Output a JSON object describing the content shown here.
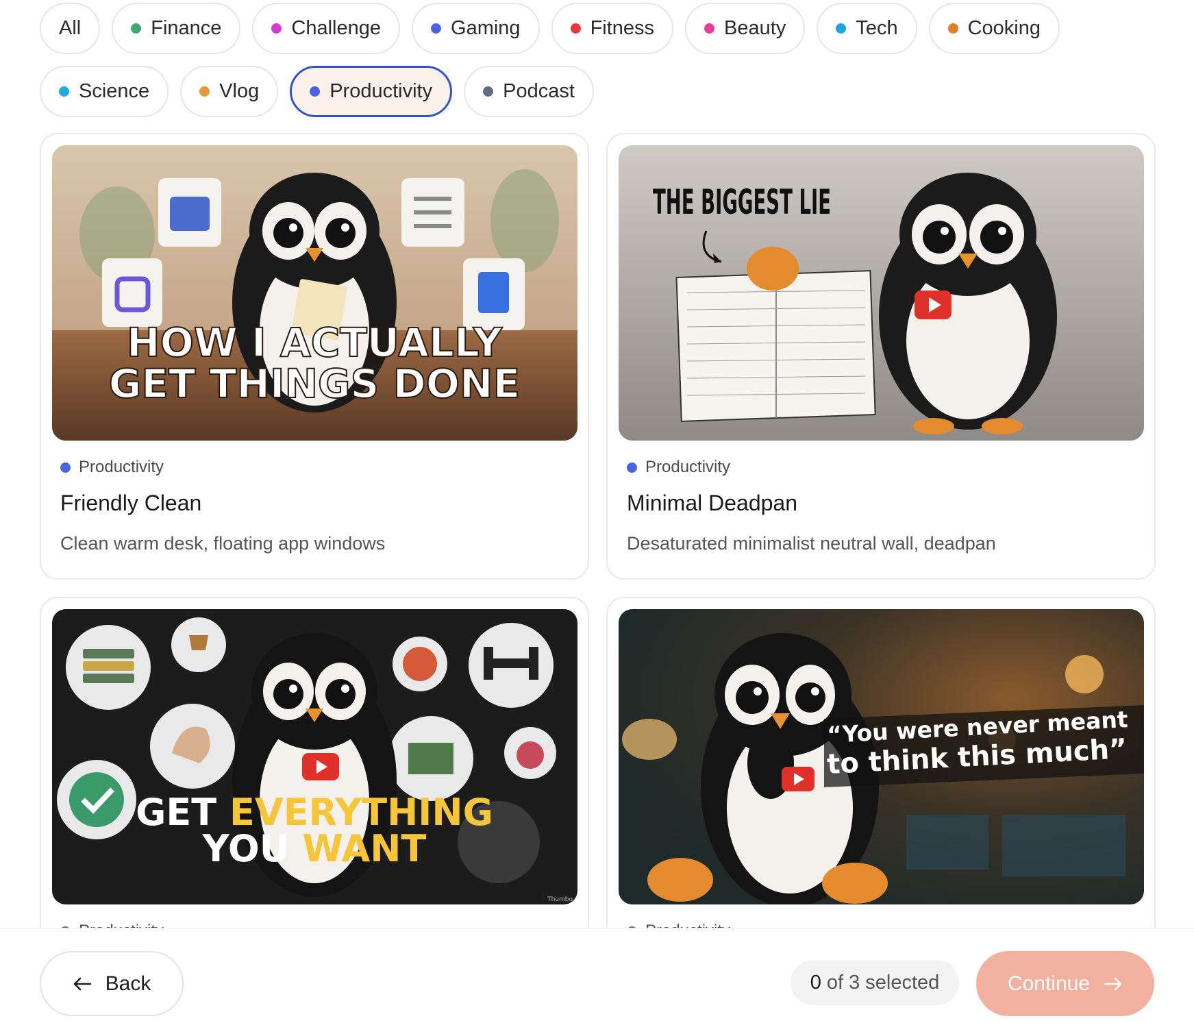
{
  "filters": [
    {
      "label": "All",
      "dot": ""
    },
    {
      "label": "Finance",
      "dot": "#3fa877"
    },
    {
      "label": "Challenge",
      "dot": "#d23ad0"
    },
    {
      "label": "Gaming",
      "dot": "#4a63e0"
    },
    {
      "label": "Fitness",
      "dot": "#e43a3f"
    },
    {
      "label": "Beauty",
      "dot": "#e23f9a"
    },
    {
      "label": "Tech",
      "dot": "#22a2e0"
    },
    {
      "label": "Cooking",
      "dot": "#e0802a"
    },
    {
      "label": "Science",
      "dot": "#22a9e0"
    },
    {
      "label": "Vlog",
      "dot": "#e49a3a"
    },
    {
      "label": "Productivity",
      "dot": "#4a63e0",
      "active": true
    },
    {
      "label": "Podcast",
      "dot": "#5f6f7d"
    }
  ],
  "cards": [
    {
      "category": "Productivity",
      "category_color": "#4a63e0",
      "title": "Friendly Clean",
      "description": "Clean warm desk, floating app windows",
      "thumb_text_lines": [
        "HOW I ACTUALLY",
        "GET THINGS DONE"
      ]
    },
    {
      "category": "Productivity",
      "category_color": "#4a63e0",
      "title": "Minimal Deadpan",
      "description": "Desaturated minimalist neutral wall, deadpan",
      "thumb_text_lines": [
        "THE BIGGEST LIE"
      ]
    },
    {
      "category": "Productivity",
      "category_color": "#4a63e0",
      "title": "",
      "description": "",
      "thumb_text_lines": [
        "GET ",
        "EVERYTHING",
        "YOU ",
        "WANT"
      ],
      "watermark": "Thumbo"
    },
    {
      "category": "Productivity",
      "category_color": "#4a63e0",
      "title": "",
      "description": "",
      "thumb_text_lines": [
        "“You were  never meant",
        "to think this much”"
      ]
    }
  ],
  "footer": {
    "back_label": "Back",
    "selected_count": "0",
    "selected_suffix": "of 3 selected",
    "continue_label": "Continue",
    "accent": "#f2b19e",
    "active_border": "#2f55c9"
  }
}
